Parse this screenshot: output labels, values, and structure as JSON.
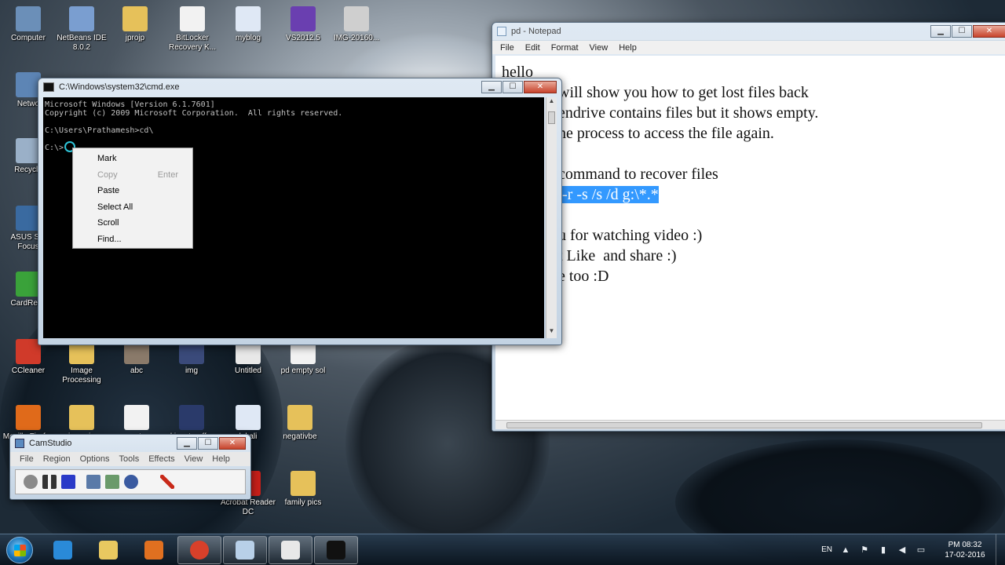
{
  "desktop": {
    "icons": [
      {
        "label": "Computer",
        "icon": "computer-icon",
        "color": "#6b8fb8"
      },
      {
        "label": "NetBeans IDE 8.0.2",
        "icon": "netbeans-icon",
        "color": "#7a9ed0"
      },
      {
        "label": "jprojp",
        "icon": "folder-icon",
        "color": "#e6c15a"
      },
      {
        "label": "BitLocker Recovery K...",
        "icon": "text-file-icon",
        "color": "#f2f2f2"
      },
      {
        "label": "myblog",
        "icon": "word-doc-icon",
        "color": "#dfe8f5"
      },
      {
        "label": "VS2012.5",
        "icon": "visual-studio-icon",
        "color": "#6a3fb0"
      },
      {
        "label": "IMG-20160...",
        "icon": "image-file-icon",
        "color": "#cfcfcf"
      },
      {
        "label": "Netwo",
        "icon": "network-icon",
        "color": "#5d85b5"
      },
      {
        "label": "Recycle",
        "icon": "recycle-bin-icon",
        "color": "#9ab0c8"
      },
      {
        "label": "ASUS Sm Focus",
        "icon": "asus-icon",
        "color": "#3a6aa0"
      },
      {
        "label": "CardReco",
        "icon": "cardrecovery-icon",
        "color": "#3aa23a"
      },
      {
        "label": "CCleaner",
        "icon": "ccleaner-icon",
        "color": "#d03a2a"
      },
      {
        "label": "Image Processing",
        "icon": "folder-icon",
        "color": "#e6c15a"
      },
      {
        "label": "abc",
        "icon": "image-file-icon",
        "color": "#8a7a6a"
      },
      {
        "label": "img",
        "icon": "image-file-icon",
        "color": "#3a4a7a"
      },
      {
        "label": "Untitled",
        "icon": "image-file-icon",
        "color": "#e8e8e8"
      },
      {
        "label": "pd empty sol",
        "icon": "text-file-icon",
        "color": "#f2f2f2"
      },
      {
        "label": "Mozilla Firefox",
        "icon": "firefox-icon",
        "color": "#e06a1a"
      },
      {
        "label": "im-pr-ja",
        "icon": "folder-icon",
        "color": "#e6c15a"
      },
      {
        "label": "art",
        "icon": "text-file-icon",
        "color": "#f2f2f2"
      },
      {
        "label": "kinectgraff...",
        "icon": "image-file-icon",
        "color": "#2a3a6a"
      },
      {
        "label": "k kali",
        "icon": "word-doc-icon",
        "color": "#dfe8f5"
      },
      {
        "label": "negativbe",
        "icon": "folder-icon",
        "color": "#e6c15a"
      },
      {
        "label": "Acrobat Reader DC",
        "icon": "acrobat-icon",
        "color": "#c8201a"
      },
      {
        "label": "family pics",
        "icon": "folder-icon",
        "color": "#e6c15a"
      }
    ]
  },
  "notepad": {
    "title": "pd - Notepad",
    "menu": [
      "File",
      "Edit",
      "Format",
      "View",
      "Help"
    ],
    "lines": [
      {
        "text": "hello",
        "highlight": ""
      },
      {
        "text": "will show you how to get lost files back",
        "highlight": ""
      },
      {
        "text": "endrive contains files but it shows empty.",
        "highlight": ""
      },
      {
        "text": "he process to access the file again.",
        "highlight": ""
      },
      {
        "text": "",
        "highlight": ""
      },
      {
        "text": "command to recover files",
        "highlight": ""
      },
      {
        "text": "",
        "highlight": " -r -s /s /d g:\\*.*"
      },
      {
        "text": "",
        "highlight": ""
      },
      {
        "text": "u for watching video :)",
        "highlight": ""
      },
      {
        "text": "t Like  and share :)",
        "highlight": ""
      },
      {
        "text": "e too :D",
        "highlight": ""
      }
    ]
  },
  "cmd": {
    "title": "C:\\Windows\\system32\\cmd.exe",
    "output": "Microsoft Windows [Version 6.1.7601]\nCopyright (c) 2009 Microsoft Corporation.  All rights reserved.\n\nC:\\Users\\Prathamesh>cd\\\n\nC:\\>"
  },
  "context_menu": {
    "items": [
      {
        "label": "Mark",
        "shortcut": "",
        "enabled": true
      },
      {
        "label": "Copy",
        "shortcut": "Enter",
        "enabled": false
      },
      {
        "label": "Paste",
        "shortcut": "",
        "enabled": true
      },
      {
        "label": "Select All",
        "shortcut": "",
        "enabled": true
      },
      {
        "label": "Scroll",
        "shortcut": "",
        "enabled": true
      },
      {
        "label": "Find...",
        "shortcut": "",
        "enabled": true
      }
    ]
  },
  "camstudio": {
    "title": "CamStudio",
    "menu": [
      "File",
      "Region",
      "Options",
      "Tools",
      "Effects",
      "View",
      "Help"
    ]
  },
  "taskbar": {
    "apps": [
      {
        "name": "internet-explorer-icon",
        "active": false
      },
      {
        "name": "file-explorer-icon",
        "active": false
      },
      {
        "name": "media-player-icon",
        "active": false
      },
      {
        "name": "chrome-icon",
        "active": true
      },
      {
        "name": "notepad-icon",
        "active": true
      },
      {
        "name": "camstudio-icon",
        "active": true
      },
      {
        "name": "cmd-icon",
        "active": true
      }
    ],
    "language": "EN",
    "time": "PM 08:32",
    "date": "17-02-2016"
  }
}
